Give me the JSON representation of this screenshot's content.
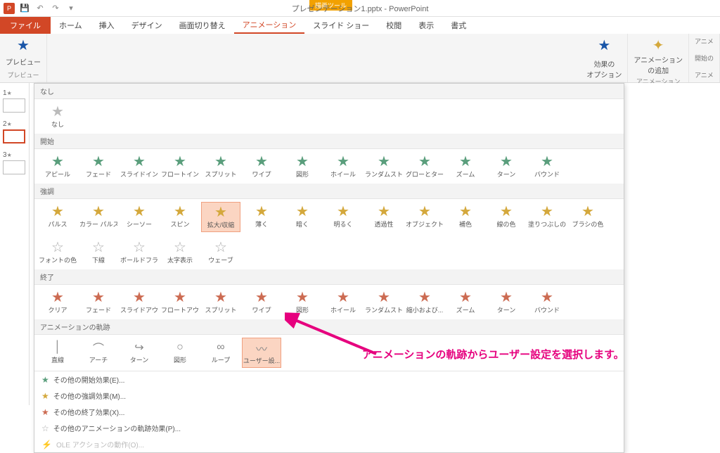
{
  "title": "プレゼンテーション1.pptx - PowerPoint",
  "context_tool": "描画ツール",
  "tabs": {
    "file": "ファイル",
    "home": "ホーム",
    "insert": "挿入",
    "design": "デザイン",
    "transitions": "画面切り替え",
    "animations": "アニメーション",
    "slideshow": "スライド ショー",
    "review": "校閲",
    "view": "表示",
    "format": "書式"
  },
  "ribbon": {
    "preview": "プレビュー",
    "preview_group": "プレビュー",
    "effect_options": "効果の\nオプション",
    "add_animation": "アニメーション\nの追加",
    "anim_group_right": "アニメーション",
    "right1": "アニメ",
    "right2": "開始の",
    "right3": "アニメ"
  },
  "gallery": {
    "none_header": "なし",
    "none_item": "なし",
    "entrance_header": "開始",
    "entrance": [
      "アピール",
      "フェード",
      "スライドイン",
      "フロートイン",
      "スプリット",
      "ワイプ",
      "図形",
      "ホイール",
      "ランダムスト...",
      "グローとターン",
      "ズーム",
      "ターン",
      "バウンド"
    ],
    "emphasis_header": "強調",
    "emphasis_r1": [
      "パルス",
      "カラー パルス",
      "シーソー",
      "スピン",
      "拡大/収縮",
      "薄く",
      "暗く",
      "明るく",
      "透過性",
      "オブジェクト ...",
      "補色",
      "線の色",
      "塗りつぶしの色",
      "ブラシの色"
    ],
    "emphasis_r2": [
      "フォントの色",
      "下線",
      "ボールドフラ...",
      "太字表示",
      "ウェーブ"
    ],
    "exit_header": "終了",
    "exit": [
      "クリア",
      "フェード",
      "スライドアウト",
      "フロートアウト",
      "スプリット",
      "ワイプ",
      "図形",
      "ホイール",
      "ランダムスト...",
      "縮小および...",
      "ズーム",
      "ターン",
      "バウンド"
    ],
    "motion_header": "アニメーションの軌跡",
    "motion": [
      "直線",
      "アーチ",
      "ターン",
      "図形",
      "ループ",
      "ユーザー設..."
    ],
    "footer": {
      "more_entrance": "その他の開始効果(E)...",
      "more_emphasis": "その他の強調効果(M)...",
      "more_exit": "その他の終了効果(X)...",
      "more_motion": "その他のアニメーションの軌跡効果(P)...",
      "ole": "OLE アクションの動作(O)..."
    }
  },
  "thumbs": [
    "1",
    "2",
    "3"
  ],
  "annotation": "アニメーションの軌跡からユーザー設定を選択します。"
}
